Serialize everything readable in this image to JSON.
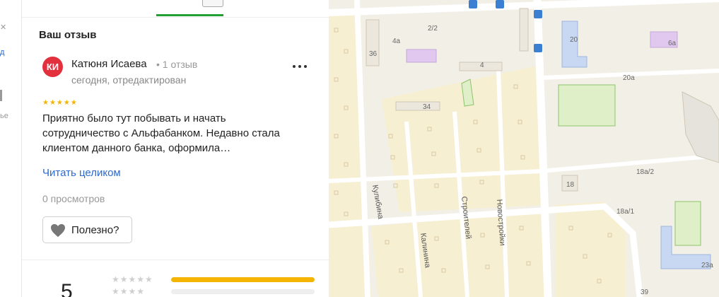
{
  "leftstrip": {
    "fragment_top": "д",
    "fragment_bottom": "ье"
  },
  "review": {
    "section_title": "Ваш отзыв",
    "avatar_initials": "КИ",
    "author_name": "Катюня Исаева",
    "author_reviews": "• 1 отзыв",
    "date": "сегодня, отредактирован",
    "stars": "★★★★★",
    "text": "Приятно было тут побывать и начать сотрудничество с Альфабанком. Недавно стала клиентом данного банка, оформила…",
    "read_more": "Читать целиком",
    "views": "0 просмотров",
    "useful_label": "Полезно?"
  },
  "ratings": {
    "average": "5",
    "rows": [
      {
        "stars": "★★★★★",
        "fill": 1.0
      },
      {
        "stars": "★★★★",
        "fill": 0.0
      }
    ]
  },
  "map": {
    "building_labels": [
      "2/2",
      "4а",
      "36",
      "4",
      "34",
      "20",
      "6а",
      "20а",
      "18а/2",
      "18",
      "18а/1",
      "23а",
      "39"
    ],
    "streets": [
      "Кулибина",
      "Калинина",
      "Строителей",
      "Новостройки"
    ],
    "colors": {
      "residential": "#f7efd2",
      "road": "#ffffff",
      "park": "#dff0c8",
      "bus": "#3a7fd1",
      "purple": "#e0c8ef",
      "blue_bldg": "#c8d8f2"
    }
  }
}
